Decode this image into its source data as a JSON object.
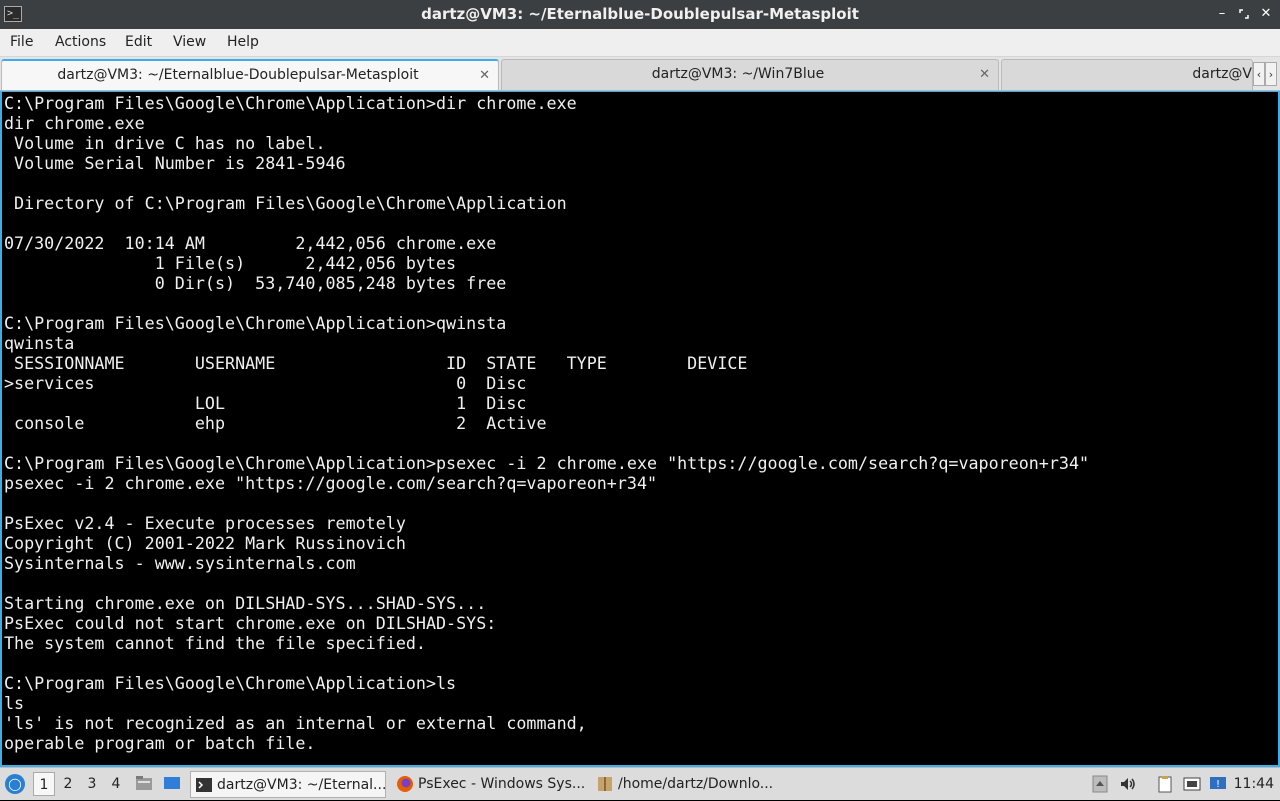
{
  "window": {
    "title": "dartz@VM3: ~/Eternalblue-Doublepulsar-Metasploit",
    "app_icon": "terminal-icon",
    "controls": [
      "minimize-icon",
      "maximize-icon",
      "close-icon"
    ]
  },
  "menubar": {
    "items": [
      "File",
      "Actions",
      "Edit",
      "View",
      "Help"
    ]
  },
  "tabs": [
    {
      "label": "dartz@VM3: ~/Eternalblue-Doublepulsar-Metasploit",
      "active": true
    },
    {
      "label": "dartz@VM3: ~/Win7Blue",
      "active": false
    },
    {
      "label": "dartz@V",
      "active": false
    }
  ],
  "tab_scroll": {
    "left": "‹",
    "right": "›"
  },
  "terminal": {
    "lines": [
      "C:\\Program Files\\Google\\Chrome\\Application>dir chrome.exe",
      "dir chrome.exe",
      " Volume in drive C has no label.",
      " Volume Serial Number is 2841-5946",
      "",
      " Directory of C:\\Program Files\\Google\\Chrome\\Application",
      "",
      "07/30/2022  10:14 AM         2,442,056 chrome.exe",
      "               1 File(s)      2,442,056 bytes",
      "               0 Dir(s)  53,740,085,248 bytes free",
      "",
      "C:\\Program Files\\Google\\Chrome\\Application>qwinsta",
      "qwinsta",
      " SESSIONNAME       USERNAME                 ID  STATE   TYPE        DEVICE",
      ">services                                    0  Disc",
      "                   LOL                       1  Disc",
      " console           ehp                       2  Active",
      "",
      "C:\\Program Files\\Google\\Chrome\\Application>psexec -i 2 chrome.exe \"https://google.com/search?q=vaporeon+r34\"",
      "psexec -i 2 chrome.exe \"https://google.com/search?q=vaporeon+r34\"",
      "",
      "PsExec v2.4 - Execute processes remotely",
      "Copyright (C) 2001-2022 Mark Russinovich",
      "Sysinternals - www.sysinternals.com",
      "",
      "Starting chrome.exe on DILSHAD-SYS...SHAD-SYS...",
      "PsExec could not start chrome.exe on DILSHAD-SYS:",
      "The system cannot find the file specified.",
      "",
      "C:\\Program Files\\Google\\Chrome\\Application>ls",
      "ls",
      "'ls' is not recognized as an internal or external command,",
      "operable program or batch file."
    ]
  },
  "taskbar": {
    "workspaces": [
      "1",
      "2",
      "3",
      "4"
    ],
    "active_workspace": "1",
    "tasks": [
      {
        "label": "dartz@VM3: ~/Eternal...",
        "icon": "terminal-icon",
        "active": true
      },
      {
        "label": "PsExec - Windows Sys...",
        "icon": "firefox-icon",
        "active": false
      },
      {
        "label": "/home/dartz/Downlo...",
        "icon": "archive-icon",
        "active": false
      }
    ],
    "clock": "11:44"
  }
}
